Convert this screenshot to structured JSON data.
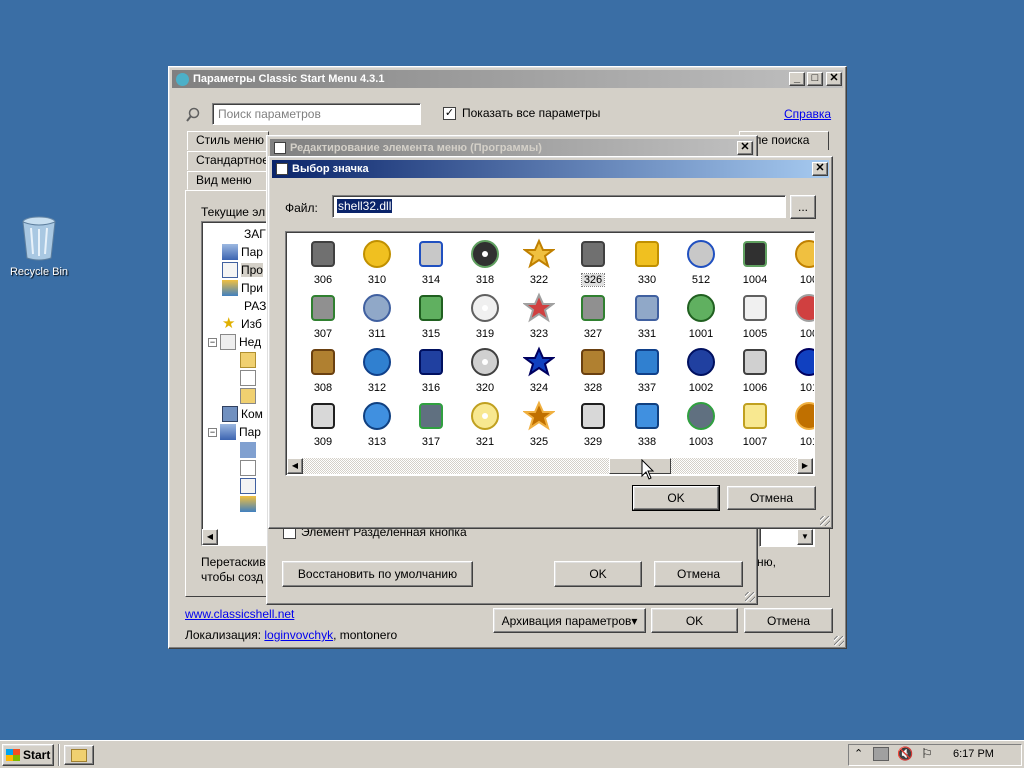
{
  "desktop": {
    "recycle_bin_label": "Recycle Bin"
  },
  "main_window": {
    "title": "Параметры Classic Start Menu 4.3.1",
    "search_placeholder": "Поиск параметров",
    "show_all_label": "Показать все параметры",
    "help_link": "Справка",
    "tabs": [
      "Стиль меню",
      "Стандартное",
      "Вид меню",
      "оле поиска"
    ],
    "current_items_label": "Текущие эл",
    "tree_items": [
      "ЗАГ",
      "Пар",
      "Про",
      "При",
      "РАЗ",
      "Изб",
      "Нед",
      "Ком",
      "Пар"
    ],
    "drag_text_line1": "Перетаскив",
    "drag_text_line2": "чтобы созд",
    "right_text_line1": "ню,",
    "right_text_line2": "",
    "website_link": "www.classicshell.net",
    "localization_label": "Локализация:",
    "localization_link": "loginvovchyk",
    "localization_rest": ", montonero",
    "backup_button": "Архивация параметров▾",
    "ok_button": "OK",
    "cancel_button": "Отмена"
  },
  "edit_window": {
    "title": "Редактирование элемента меню (Программы)",
    "checkbox_label": "Элемент  Разделенная кнопка",
    "restore_button": "Восстановить по умолчанию",
    "ok_button": "OK",
    "cancel_button": "Отмена"
  },
  "icon_dialog": {
    "title": "Выбор значка",
    "file_label": "Файл:",
    "file_value": "shell32.dll",
    "browse_button": "...",
    "ok_button": "OK",
    "cancel_button": "Отмена",
    "columns": [
      [
        "306",
        "307",
        "308",
        "309"
      ],
      [
        "310",
        "311",
        "312",
        "313"
      ],
      [
        "314",
        "315",
        "316",
        "317"
      ],
      [
        "318",
        "319",
        "320",
        "321"
      ],
      [
        "322",
        "323",
        "324",
        "325"
      ],
      [
        "326",
        "327",
        "328",
        "329"
      ],
      [
        "330",
        "331",
        "337",
        "338"
      ],
      [
        "512",
        "1001",
        "1002",
        "1003"
      ],
      [
        "1004",
        "1005",
        "1006",
        "1007"
      ],
      [
        "100",
        "100",
        "101",
        "101"
      ]
    ],
    "selected": "326"
  },
  "taskbar": {
    "start_label": "Start",
    "clock": "6:17 PM"
  }
}
